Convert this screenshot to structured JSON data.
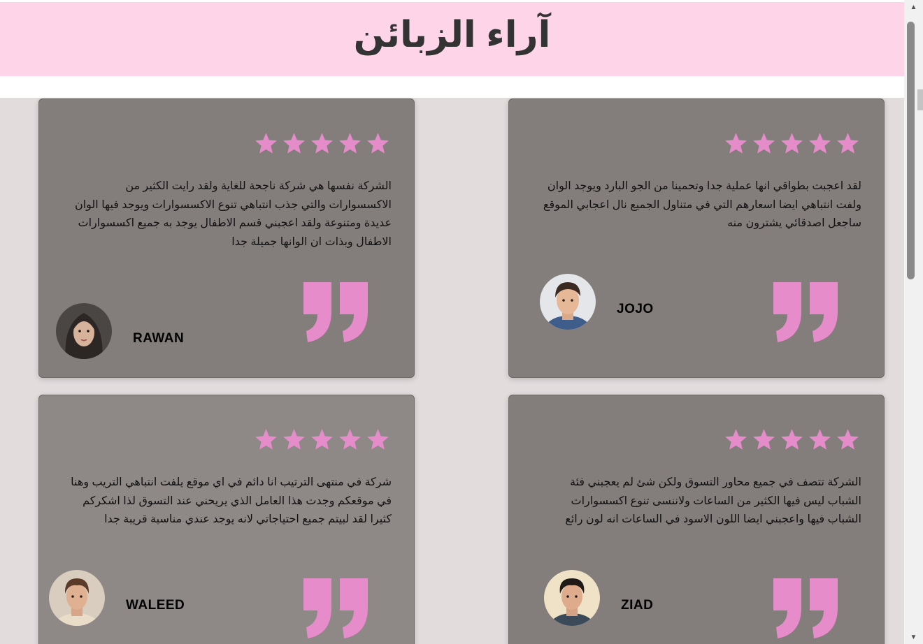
{
  "page": {
    "title": "آراء الزبائن"
  },
  "colors": {
    "header_bg": "#fed4e8",
    "section_bg": "#e2dcdd",
    "card_bg": "#837d7c",
    "accent_pink": "#e78ccb"
  },
  "reviews": [
    {
      "name": "JOJO",
      "rating": 5,
      "text": "لقد اعجبت بطواقي انها عملية جدا وتحمينا من الجو البارد ويوجد الوان ولفت انتباهي ايضا اسعارهم التي في متناول الجميع نال اعجابي الموقع ساجعل اصدقائي يشترون منه",
      "avatar_icon": "avatar-male-icon"
    },
    {
      "name": "RAWAN",
      "rating": 5,
      "text": "الشركة نفسها هي شركة ناجحة للغاية ولقد رايت الكثير من الاكسسوارات والتي جذب انتباهي تنوع الاكسسوارات ويوجد فيها الوان عديدة ومتنوعة ولقد اعجبني قسم الاطفال يوجد به جميع اكسسوارات الاطفال وبذات ان الوانها جميلة جدا",
      "avatar_icon": "avatar-female-icon"
    },
    {
      "name": "ZIAD",
      "rating": 5,
      "text": "الشركة تتصف في جميع محاور التسوق ولكن شئ لم يعجبني فئة الشباب ليس فيها الكثير من الساعات ولاننسى تنوع اكسسوارات الشباب فيها واعجبني ايضا اللون الاسود في الساعات انه لون رائع",
      "avatar_icon": "avatar-male-icon"
    },
    {
      "name": "WALEED",
      "rating": 5,
      "text": "شركة في منتهى الترتيب انا دائم في اي موقع يلفت انتباهي التريب وهنا في موقعكم وجدت هذا العامل الذي يريحني عند التسوق لذا اشكركم كثيرا لقد لبيتم جميع احتياجاتي لانه يوجد عندي مناسبة قريبة جدا",
      "avatar_icon": "avatar-male-icon"
    }
  ]
}
